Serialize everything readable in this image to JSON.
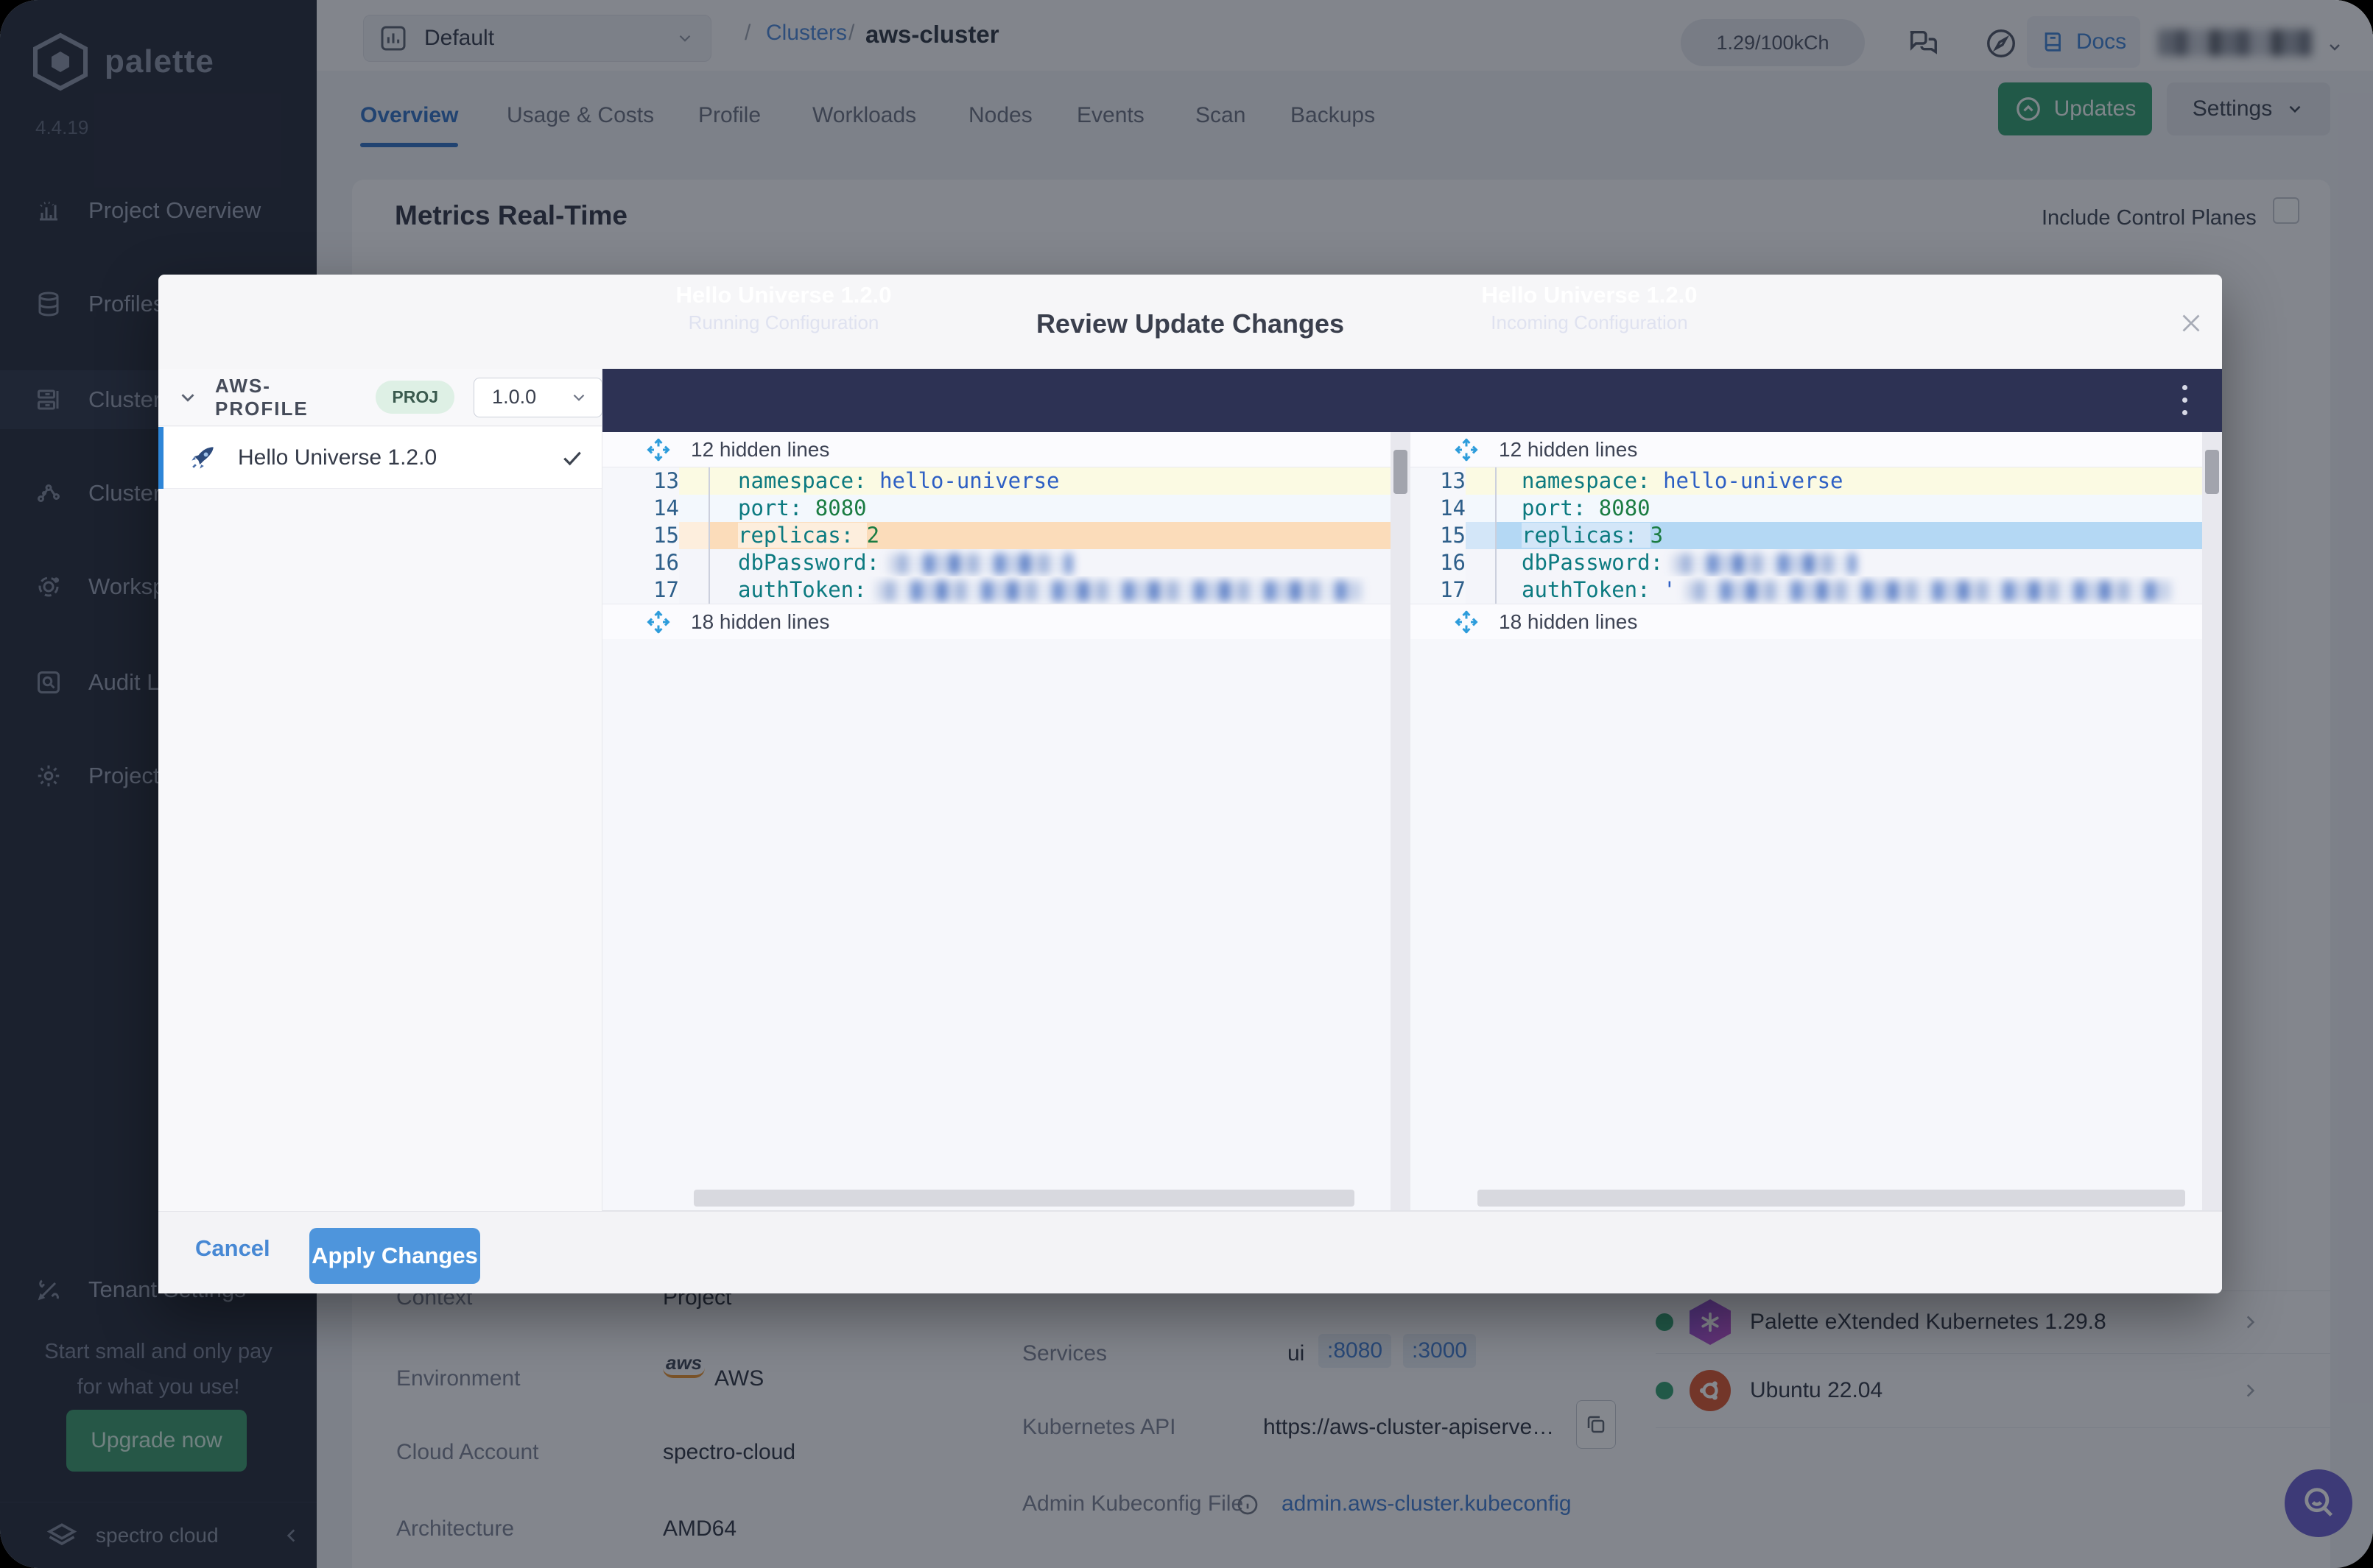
{
  "app": {
    "name": "palette",
    "version": "4.4.19"
  },
  "sidebar": {
    "items": [
      {
        "label": "Project Overview"
      },
      {
        "label": "Profiles"
      },
      {
        "label": "Clusters"
      },
      {
        "label": "Cluster Groups"
      },
      {
        "label": "Workspaces"
      },
      {
        "label": "Audit Logs"
      },
      {
        "label": "Project Settings"
      },
      {
        "label": "Tenant Settings"
      }
    ],
    "promo": {
      "line1": "Start small and only pay",
      "line2": "for what you use!",
      "cta": "Upgrade now"
    },
    "footer": {
      "brand": "spectro cloud"
    }
  },
  "topbar": {
    "project_selector": "Default",
    "breadcrumb": {
      "slash": "/",
      "section": "Clusters",
      "current": "aws-cluster"
    },
    "usage_badge": "1.29/100kCh",
    "docs_label": "Docs"
  },
  "tabs": {
    "items": [
      "Overview",
      "Usage & Costs",
      "Profile",
      "Workloads",
      "Nodes",
      "Events",
      "Scan",
      "Backups"
    ],
    "active": "Overview"
  },
  "actions": {
    "updates": "Updates",
    "settings": "Settings"
  },
  "content": {
    "heading": "Metrics Real-Time",
    "include_control_planes": "Include Control Planes"
  },
  "overview": {
    "context": {
      "label": "Context",
      "value": "Project"
    },
    "environment": {
      "label": "Environment",
      "value": "AWS"
    },
    "cloud_account": {
      "label": "Cloud Account",
      "value": "spectro-cloud"
    },
    "architecture": {
      "label": "Architecture",
      "value": "AMD64"
    },
    "services": {
      "label": "Services",
      "name": "ui",
      "port1": ":8080",
      "port2": ":3000"
    },
    "kubernetes_api": {
      "label": "Kubernetes API",
      "value": "https://aws-cluster-apiserve…"
    },
    "kubeconfig": {
      "label": "Admin Kubeconfig File",
      "value": "admin.aws-cluster.kubeconfig"
    },
    "packs": [
      {
        "label": "Palette eXtended Kubernetes 1.29.8"
      },
      {
        "label": "Ubuntu 22.04"
      }
    ]
  },
  "modal": {
    "title": "Review Update Changes",
    "profile_bar": {
      "name": "AWS-PROFILE",
      "scope": "PROJ",
      "version": "1.0.0"
    },
    "profile_item": {
      "label": "Hello Universe 1.2.0"
    },
    "footer": {
      "cancel": "Cancel",
      "apply": "Apply Changes"
    }
  },
  "diff": {
    "left": {
      "title": "Hello Universe 1.2.0",
      "subtitle": "Running Configuration",
      "hidden_top": "12 hidden lines",
      "hidden_bottom": "18 hidden lines",
      "lines": [
        {
          "n": "13",
          "key": "namespace:",
          "value": "hello-universe"
        },
        {
          "n": "14",
          "key": "port:",
          "value": "8080"
        },
        {
          "n": "15",
          "key": "replicas:",
          "value": "2"
        },
        {
          "n": "16",
          "key": "dbPassword:",
          "value": ""
        },
        {
          "n": "17",
          "key": "authToken:",
          "value": ""
        }
      ]
    },
    "right": {
      "title": "Hello Universe 1.2.0",
      "subtitle": "Incoming Configuration",
      "hidden_top": "12 hidden lines",
      "hidden_bottom": "18 hidden lines",
      "lines": [
        {
          "n": "13",
          "key": "namespace:",
          "value": "hello-universe"
        },
        {
          "n": "14",
          "key": "port:",
          "value": "8080"
        },
        {
          "n": "15",
          "key": "replicas:",
          "value": "3"
        },
        {
          "n": "16",
          "key": "dbPassword:",
          "value": ""
        },
        {
          "n": "17",
          "key": "authToken:",
          "value": "'"
        }
      ]
    }
  },
  "colors": {
    "accent_blue": "#4e95dc",
    "navy_header": "#2d3254",
    "diff_removed": "#fbdcba",
    "diff_added": "#b4d8f4",
    "green": "#2f9e6e",
    "purple_fab": "#6a5cd0",
    "sidebar_bg": "#222938"
  }
}
